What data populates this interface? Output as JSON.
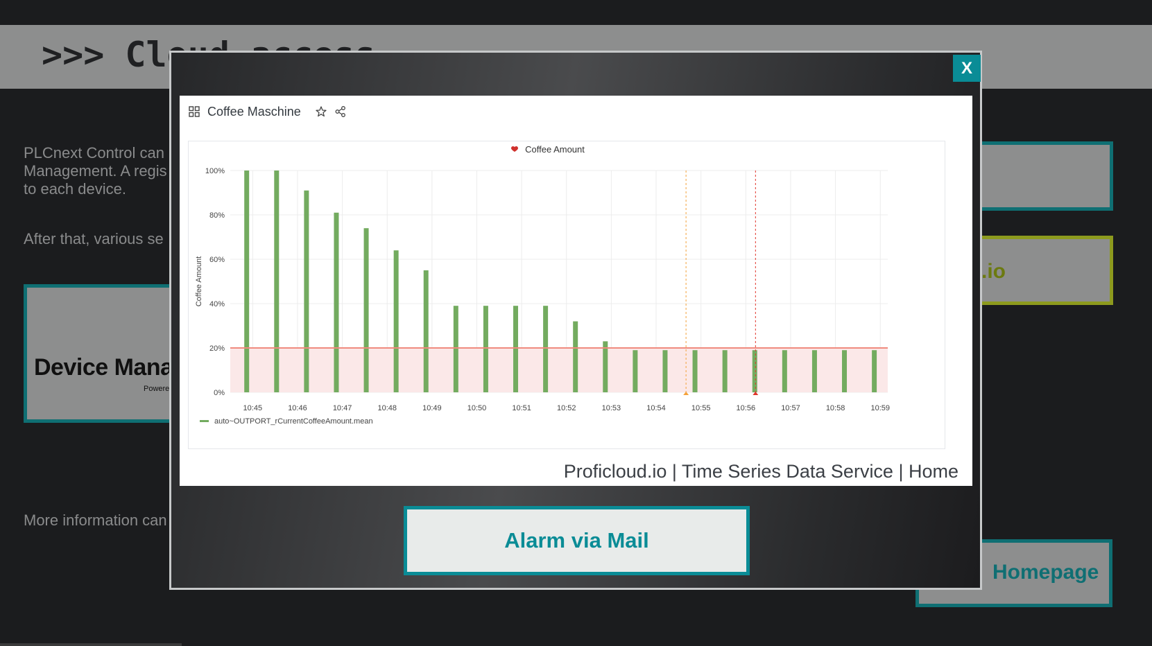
{
  "background": {
    "title": ">>> Cloud access",
    "paragraph1": "PLCnext Control can\nManagement. A regis\nto each device.",
    "paragraph2": "After that, various se",
    "paragraph3": "More information can",
    "device_card_text": "Device Mana",
    "device_card_sub": "Powered",
    "button2_label": ".io",
    "button3_label": "Homepage"
  },
  "modal": {
    "close_label": "X",
    "dashboard_title": "Coffee Maschine",
    "footer_link": "Proficloud.io | Time Series Data Service | Home",
    "alarm_button_label": "Alarm via Mail"
  },
  "colors": {
    "accent": "#0a8c96",
    "bar": "#73ab5f",
    "threshold": "#f08a7e",
    "threshold_fill": "#fbe8e8"
  },
  "chart_data": {
    "type": "bar",
    "title": "Coffee Amount",
    "ylabel": "Coffee Amount",
    "xlabel": "",
    "ylim": [
      0,
      100
    ],
    "yticks": [
      "0%",
      "20%",
      "40%",
      "60%",
      "80%",
      "100%"
    ],
    "xticks": [
      "10:45",
      "10:46",
      "10:47",
      "10:48",
      "10:49",
      "10:50",
      "10:51",
      "10:52",
      "10:53",
      "10:54",
      "10:55",
      "10:56",
      "10:57",
      "10:58",
      "10:59"
    ],
    "threshold": 20,
    "annotations": [
      {
        "x": "10:54:40",
        "color": "orange"
      },
      {
        "x": "10:56:13",
        "color": "red"
      }
    ],
    "series": [
      {
        "name": "auto~OUTPORT_rCurrentCoffeeAmount.mean",
        "points": [
          {
            "t": "10:44:52",
            "v": 100
          },
          {
            "t": "10:45:32",
            "v": 100
          },
          {
            "t": "10:46:12",
            "v": 91
          },
          {
            "t": "10:46:52",
            "v": 81
          },
          {
            "t": "10:47:32",
            "v": 74
          },
          {
            "t": "10:48:12",
            "v": 64
          },
          {
            "t": "10:48:52",
            "v": 55
          },
          {
            "t": "10:49:32",
            "v": 39
          },
          {
            "t": "10:50:12",
            "v": 39
          },
          {
            "t": "10:50:52",
            "v": 39
          },
          {
            "t": "10:51:32",
            "v": 39
          },
          {
            "t": "10:52:12",
            "v": 32
          },
          {
            "t": "10:52:52",
            "v": 23
          },
          {
            "t": "10:53:32",
            "v": 19
          },
          {
            "t": "10:54:12",
            "v": 19
          },
          {
            "t": "10:54:52",
            "v": 19
          },
          {
            "t": "10:55:32",
            "v": 19
          },
          {
            "t": "10:56:12",
            "v": 19
          },
          {
            "t": "10:56:52",
            "v": 19
          },
          {
            "t": "10:57:32",
            "v": 19
          },
          {
            "t": "10:58:12",
            "v": 19
          },
          {
            "t": "10:58:52",
            "v": 19
          }
        ]
      }
    ]
  }
}
